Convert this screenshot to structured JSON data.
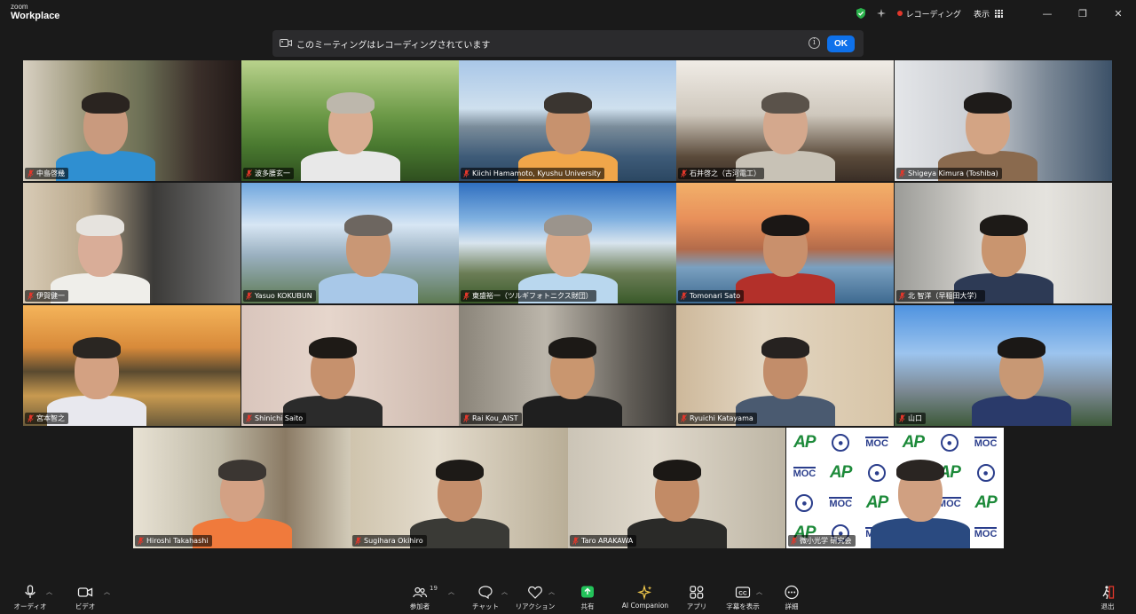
{
  "app": {
    "logo_small": "zoom",
    "logo_big": "Workplace"
  },
  "titlebar": {
    "recording_label": "レコーディング",
    "view_label": "表示",
    "minimize": "—",
    "maximize": "❐",
    "close": "✕",
    "colors": {
      "shield": "#2bb24c",
      "record_dot": "#e2372b"
    }
  },
  "banner": {
    "text": "このミーティングはレコーディングされています",
    "info": "i",
    "ok_label": "OK",
    "ok_color": "#0e71eb"
  },
  "participants": [
    {
      "name": "中島啓幾"
    },
    {
      "name": "波多腰玄一"
    },
    {
      "name": "Kiichi Hamamoto, Kyushu University"
    },
    {
      "name": "石井啓之（古河電工）"
    },
    {
      "name": "Shigeya Kimura (Toshiba)"
    },
    {
      "name": "伊賀健一"
    },
    {
      "name": "Yasuo KOKUBUN"
    },
    {
      "name": "東盛裕一（ツルギフォトニクス財団）"
    },
    {
      "name": "Tomonari Sato"
    },
    {
      "name": "北 智洋（早稲田大学）"
    },
    {
      "name": "宮本智之"
    },
    {
      "name": "Shinichi Saito"
    },
    {
      "name": "Rai Kou_AIST"
    },
    {
      "name": "Ryuichi Katayama"
    },
    {
      "name": "山口"
    },
    {
      "name": "Hiroshi Takahashi"
    },
    {
      "name": "Sugihara Okihiro"
    },
    {
      "name": "Taro ARAKAWA"
    },
    {
      "name": "微小光学 研究会",
      "active": true,
      "logo_wall": [
        "AP",
        "MOC"
      ],
      "active_border_color": "#34c759"
    }
  ],
  "toolbar": {
    "audio": "オーディオ",
    "video": "ビデオ",
    "participants": "参加者",
    "participants_count": "19",
    "chat": "チャット",
    "reactions": "リアクション",
    "share": "共有",
    "ai_companion": "AI Companion",
    "apps": "アプリ",
    "captions": "字幕を表示",
    "more": "詳細",
    "leave": "退出",
    "colors": {
      "share": "#23c35a"
    }
  }
}
